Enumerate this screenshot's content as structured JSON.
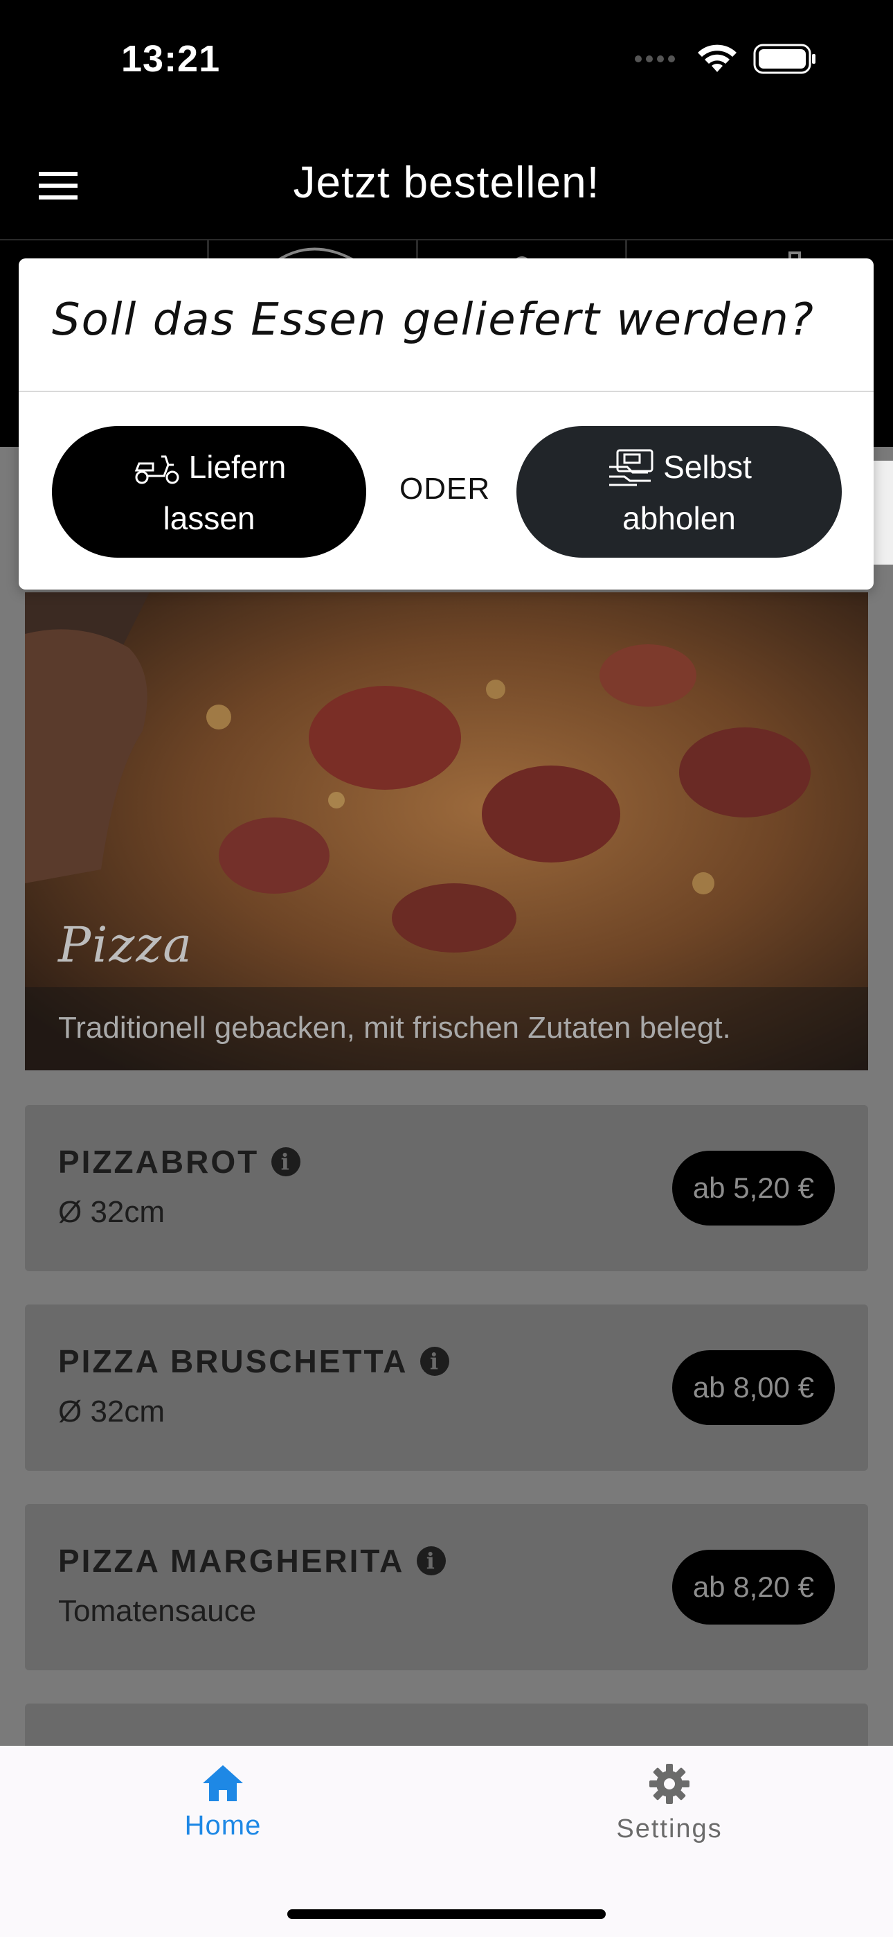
{
  "status_bar": {
    "time": "13:21"
  },
  "app_bar": {
    "title": "Jetzt bestellen!",
    "menu_icon": "hamburger-menu-icon"
  },
  "dialog": {
    "title": "Soll das Essen geliefert werden?",
    "deliver_line1": "Liefern",
    "deliver_line2": "lassen",
    "deliver_icon": "scooter-icon",
    "separator": "ODER",
    "pickup_line1": "Selbst",
    "pickup_line2": "abholen",
    "pickup_icon": "pickup-register-icon"
  },
  "category": {
    "title": "Pizza",
    "description": "Traditionell gebacken, mit frischen Zutaten belegt."
  },
  "items": [
    {
      "name": "PIZZABROT",
      "subtitle": "Ø 32cm",
      "price": "ab 5,20 €"
    },
    {
      "name": "PIZZA BRUSCHETTA",
      "subtitle": "Ø 32cm",
      "price": "ab 8,00 €"
    },
    {
      "name": "PIZZA MARGHERITA",
      "subtitle": "Tomatensauce",
      "price": "ab 8,20 €"
    }
  ],
  "bottom_nav": {
    "home_label": "Home",
    "settings_label": "Settings"
  },
  "colors": {
    "accent": "#1e88e5",
    "overlay_gray": "#7a7a7a",
    "dark_button": "#212529"
  }
}
